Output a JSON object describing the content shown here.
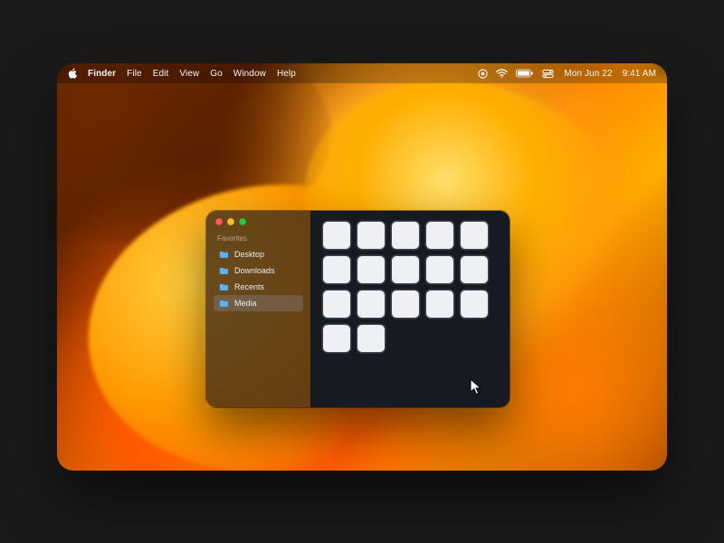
{
  "menubar": {
    "app_name": "Finder",
    "items": [
      "File",
      "Edit",
      "View",
      "Go",
      "Window",
      "Help"
    ],
    "date": "Mon Jun 22",
    "time": "9:41 AM"
  },
  "finder": {
    "sidebar": {
      "section_label": "Favorites",
      "items": [
        {
          "label": "Desktop",
          "selected": false
        },
        {
          "label": "Downloads",
          "selected": false
        },
        {
          "label": "Recents",
          "selected": false
        },
        {
          "label": "Media",
          "selected": true
        }
      ]
    },
    "content": {
      "thumbnail_count": 17
    }
  },
  "icons": {
    "apple": "apple-logo",
    "status": [
      "record-icon",
      "wifi-icon",
      "battery-icon",
      "control-center-icon"
    ]
  },
  "colors": {
    "traffic_red": "#ff5f57",
    "traffic_yellow": "#febc2e",
    "traffic_green": "#28c840",
    "folder_tint": "#56b3ff"
  }
}
